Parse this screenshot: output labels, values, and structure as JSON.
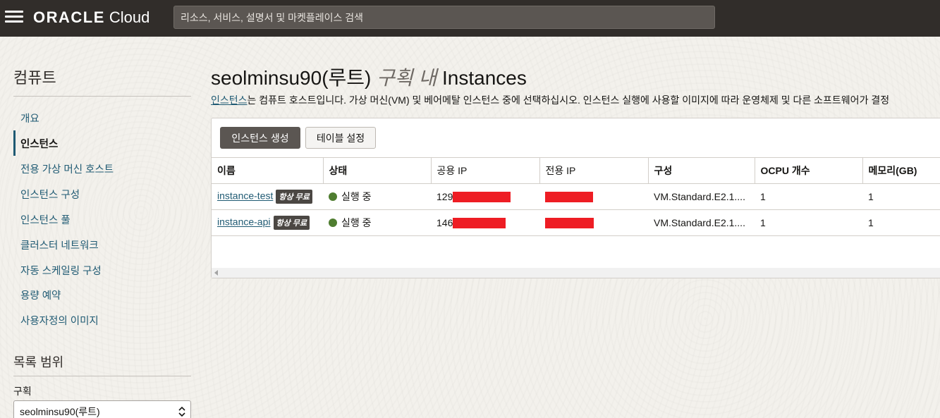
{
  "header": {
    "menu_icon": "hamburger-icon",
    "logo_brand": "ORACLE",
    "logo_product": "Cloud",
    "search_placeholder": "리소스, 서비스, 설명서 및 마켓플레이스 검색"
  },
  "sidebar": {
    "title": "컴퓨트",
    "items": [
      {
        "label": "개요",
        "active": false
      },
      {
        "label": "인스턴스",
        "active": true
      },
      {
        "label": "전용 가상 머신 호스트",
        "active": false
      },
      {
        "label": "인스턴스 구성",
        "active": false
      },
      {
        "label": "인스턴스 풀",
        "active": false
      },
      {
        "label": "클러스터 네트워크",
        "active": false
      },
      {
        "label": "자동 스케일링 구성",
        "active": false
      },
      {
        "label": "용량 예약",
        "active": false
      },
      {
        "label": "사용자정의 이미지",
        "active": false
      }
    ],
    "scope_title": "목록 범위",
    "compartment_label": "구획",
    "compartment_value": "seolminsu90(루트)"
  },
  "main": {
    "title_compartment": "seolminsu90(루트)",
    "title_in": "구획 내",
    "title_resource": "Instances",
    "desc_link": "인스턴스",
    "desc_text": "는 컴퓨트 호스트입니다. 가상 머신(VM) 및 베어메탈 인스턴스 중에 선택하십시오. 인스턴스 실행에 사용할 이미지에 따라 운영체제 및 다른 소프트웨어가 결정",
    "create_button": "인스턴스 생성",
    "table_settings_button": "테이블 설정",
    "columns": [
      "이름",
      "상태",
      "공용 IP",
      "전용 IP",
      "구성",
      "OCPU 개수",
      "메모리(GB)"
    ],
    "rows": [
      {
        "name": "instance-test",
        "badge": "항상 무료",
        "status": "실행 중",
        "public_ip_prefix": "129",
        "shape": "VM.Standard.E2.1....",
        "ocpu": "1",
        "memory": "1"
      },
      {
        "name": "instance-api",
        "badge": "항상 무료",
        "status": "실행 중",
        "public_ip_prefix": "146",
        "shape": "VM.Standard.E2.1....",
        "ocpu": "1",
        "memory": "1"
      }
    ],
    "status_color": "#4f7d30",
    "redaction_color": "#ee1d24"
  }
}
